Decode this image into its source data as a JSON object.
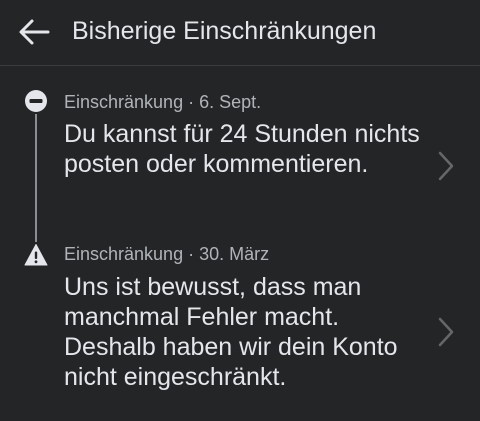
{
  "header": {
    "title": "Bisherige Einschränkungen",
    "back_icon": "arrow-left-icon"
  },
  "entries": [
    {
      "icon": "no-entry-icon",
      "type": "Einschränkung",
      "separator": "·",
      "date": "6. Sept.",
      "text": "Du kannst für 24 Stunden nichts posten oder kommentieren.",
      "chevron_icon": "chevron-right-icon"
    },
    {
      "icon": "warning-icon",
      "type": "Einschränkung",
      "separator": "·",
      "date": "30. März",
      "text": "Uns ist bewusst, dass man manchmal Fehler macht. Deshalb haben wir dein Konto nicht eingeschränkt.",
      "chevron_icon": "chevron-right-icon"
    }
  ],
  "colors": {
    "background": "#242526",
    "text_primary": "#e4e6eb",
    "text_secondary": "#b0b3b8",
    "divider": "#3a3b3c",
    "icon": "#e4e6eb",
    "chevron": "#65676b"
  }
}
